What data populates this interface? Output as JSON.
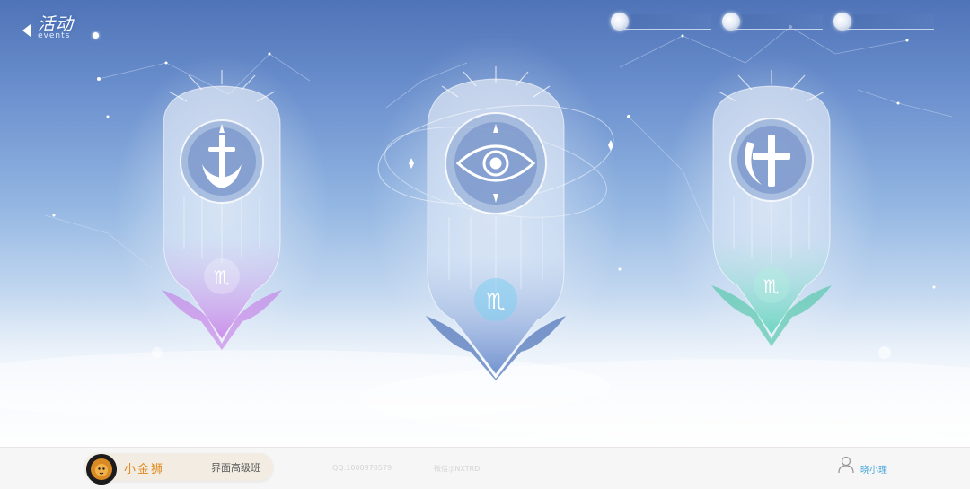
{
  "header": {
    "title": "活动",
    "title_en": "events",
    "back_icon": "back-arrow-icon"
  },
  "currencies": [
    {
      "icon": "coin-icon",
      "value": ""
    },
    {
      "icon": "coin-icon",
      "value": ""
    },
    {
      "icon": "coin-icon",
      "value": ""
    }
  ],
  "banners": [
    {
      "emblem": "sword-crest-icon",
      "sign": "♏",
      "sign_icon": "scorpio-icon",
      "accent": "#c478e6"
    },
    {
      "emblem": "eye-icon",
      "sign": "♏",
      "sign_icon": "scorpio-icon",
      "accent": "#5fb4e8"
    },
    {
      "emblem": "cross-moon-icon",
      "sign": "♏",
      "sign_icon": "scorpio-icon",
      "accent": "#58d2b8"
    }
  ],
  "footer": {
    "author": "小金狮",
    "course": "界面高级班",
    "qq": "QQ:1000970579",
    "wechat": "微信:JINXTRD",
    "user": "晓小理"
  },
  "colors": {
    "sky_top": "#4f73b7",
    "sky_bottom": "#f4f7fc",
    "author_accent": "#e08a1e",
    "user_accent": "#4aa8d8"
  }
}
